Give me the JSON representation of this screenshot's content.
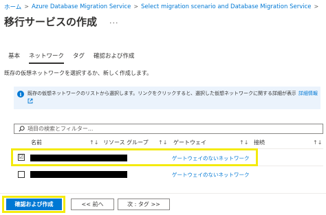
{
  "breadcrumb": {
    "items": [
      "ホーム",
      "Azure Database Migration Service",
      "Select migration scenario and Database Migration Service"
    ],
    "separator": ">"
  },
  "page": {
    "title": "移行サービスの作成",
    "more_label": "..."
  },
  "tabs": [
    {
      "label": "基本",
      "active": false
    },
    {
      "label": "ネットワーク",
      "active": true
    },
    {
      "label": "タグ",
      "active": false
    },
    {
      "label": "確認および作成",
      "active": false
    }
  ],
  "description": "既存の仮想ネットワークを選択するか、新しく作成します。",
  "info_banner": {
    "icon": "info-icon",
    "text": "既存の仮想ネットワークのリストから選択します。リンクをクリックすると、選択した仮想ネットワークに関する詳細が表示されます。",
    "link": "詳細情報",
    "link_icon": "external-link-icon"
  },
  "filter": {
    "placeholder": "項目の検索とフィルター..."
  },
  "table": {
    "columns": [
      "名前",
      "リソース グループ",
      "ゲートウェイ",
      "接続"
    ],
    "rows": [
      {
        "checked": true,
        "checkbox_mark": "☑",
        "name": "",
        "resource_group": "",
        "gateway": "ゲートウェイのないネットワーク",
        "connection": ""
      },
      {
        "checked": false,
        "checkbox_mark": "",
        "name": "",
        "resource_group": "",
        "gateway": "ゲートウェイのないネットワーク",
        "connection": ""
      }
    ]
  },
  "footer": {
    "review_create": "確認および作成",
    "previous": "<< 前へ",
    "next": "次 : タグ >>"
  },
  "colors": {
    "accent": "#0078d4",
    "highlight": "#f4ea0c",
    "info_bg": "#ebf3fc"
  }
}
